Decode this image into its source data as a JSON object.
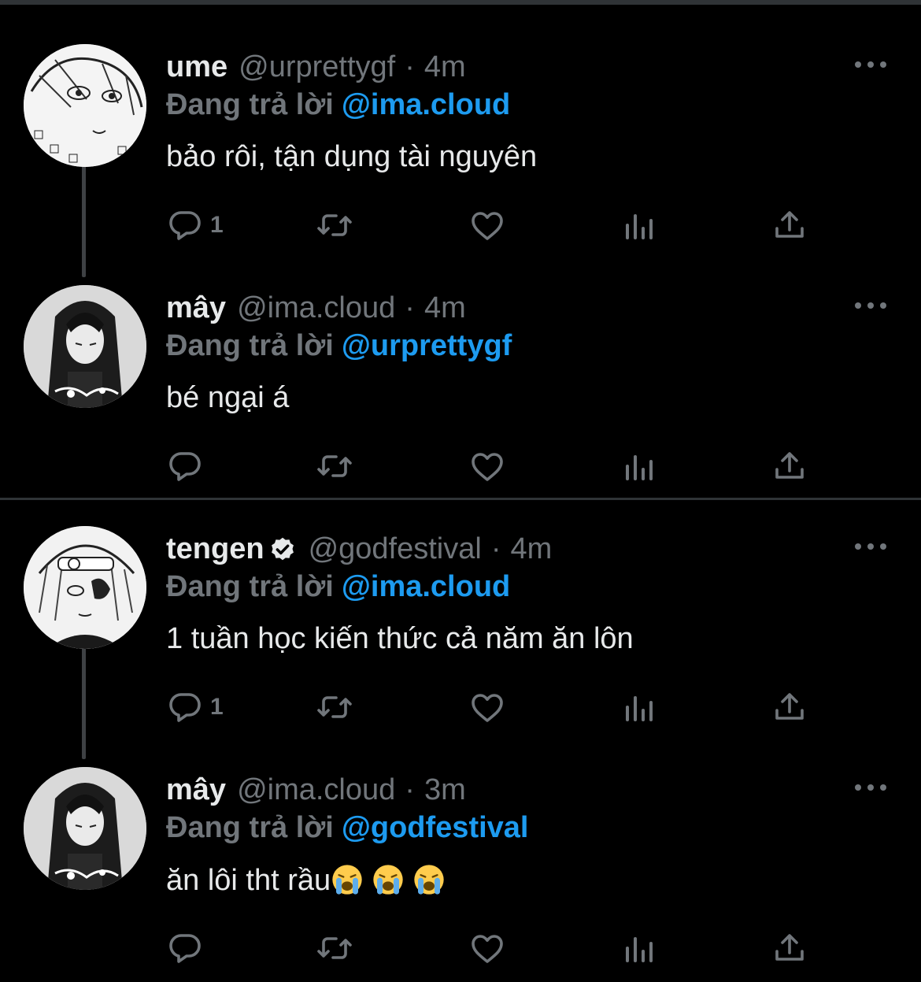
{
  "tweets": [
    {
      "name": "ume",
      "handle": "@urprettygf",
      "separator": "·",
      "time": "4m",
      "reply_label": "Đang trả lời",
      "reply_to": "@ima.cloud",
      "text": "bảo rôi, tận dụng tài nguyên",
      "reply_count": "1",
      "verified": false
    },
    {
      "name": "mây",
      "handle": "@ima.cloud",
      "separator": "·",
      "time": "4m",
      "reply_label": "Đang trả lời",
      "reply_to": "@urprettygf",
      "text": "bé ngại á",
      "reply_count": "",
      "verified": false
    },
    {
      "name": "tengen",
      "handle": "@godfestival",
      "separator": "·",
      "time": "4m",
      "reply_label": "Đang trả lời",
      "reply_to": "@ima.cloud",
      "text": "1 tuần học kiến thức cả năm ăn lôn",
      "reply_count": "1",
      "verified": true
    },
    {
      "name": "mây",
      "handle": "@ima.cloud",
      "separator": "·",
      "time": "3m",
      "reply_label": "Đang trả lời",
      "reply_to": "@godfestival",
      "text": "ăn lôi tht rầu",
      "text_emojis": [
        "loudly-crying-face",
        "loudly-crying-face",
        "loudly-crying-face"
      ],
      "reply_count": "",
      "verified": false
    }
  ],
  "icons": [
    "reply-icon",
    "retweet-icon",
    "like-icon",
    "analytics-icon",
    "share-icon",
    "more-icon",
    "verified-badge-icon"
  ],
  "colors": {
    "background": "#000000",
    "primary_text": "#e7e9ea",
    "secondary_text": "#71767b",
    "link": "#1d9bf0",
    "divider": "#2f3336"
  }
}
